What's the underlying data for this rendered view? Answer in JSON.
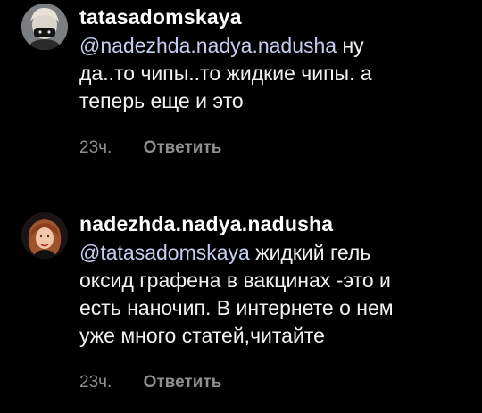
{
  "comments": [
    {
      "username": "tatasadomskaya",
      "avatar_icon": "user-avatar-masked",
      "mention": "@nadezhda.nadya.nadusha",
      "lines": [
        " ну",
        "да..то чипы..то жидкие чипы. а",
        "теперь еще и это"
      ],
      "time": "23ч.",
      "reply_label": "Ответить"
    },
    {
      "username": "nadezhda.nadya.nadusha",
      "avatar_icon": "user-avatar-portrait",
      "mention": "@tatasadomskaya",
      "lines": [
        " жидкий гель",
        "оксид графена в вакцинах -это и",
        "есть наночип. В интернете о нем",
        "уже много статей,читайте"
      ],
      "time": "23ч.",
      "reply_label": "Ответить"
    }
  ],
  "colors": {
    "background": "#000000",
    "text": "#f2f2f2",
    "username": "#ffffff",
    "mention": "#c5cdf0",
    "meta": "#8e8e8e"
  }
}
